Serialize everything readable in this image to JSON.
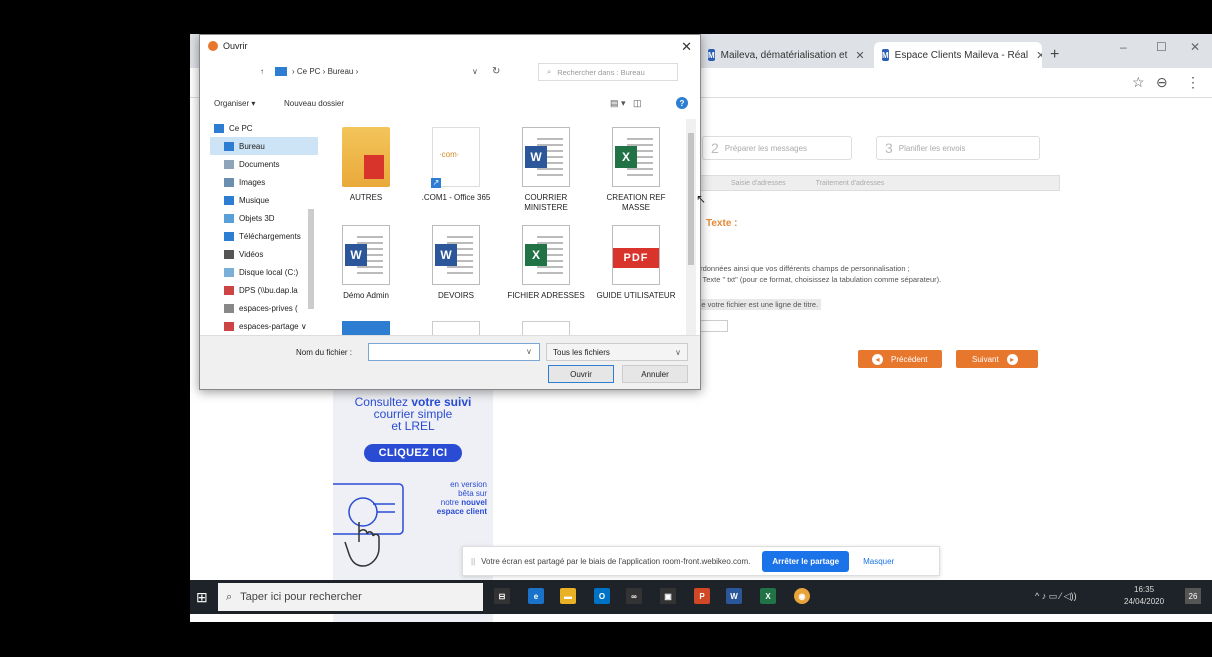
{
  "browser": {
    "tabs": [
      {
        "icon": "M",
        "label": "Maileva, dématérialisation et"
      },
      {
        "icon": "M",
        "label": "Espace Clients Maileva - Réal"
      }
    ],
    "new_tab": "+",
    "win_controls": [
      "–",
      "☐",
      "✕"
    ],
    "star_icon": "☆",
    "profile_icon": "⊖",
    "menu_icon": "⋮"
  },
  "page": {
    "steps": [
      {
        "num": "2",
        "label": "Préparer les messages"
      },
      {
        "num": "3",
        "label": "Planifier les envois"
      }
    ],
    "subtabs": [
      "Saisie d'adresses",
      "Traitement d'adresses"
    ],
    "text_label": "Texte :",
    "paragraph_1": "coordonnées ainsi que vos différents champs de personnalisation ;",
    "paragraph_2": "mat Texte \" txt\" (pour ce format, choisissez la tabulation comme séparateur).",
    "title_row": "e de votre fichier est une ligne de titre.",
    "prev_button": "Précédent",
    "next_button": "Suivant"
  },
  "promo": {
    "line1": "Consultez ",
    "line1_bold": "votre suivi",
    "line2": "courrier simple",
    "line3": "et LREL",
    "button": "CLIQUEZ ICI",
    "small1": "en version",
    "small2": "bêta sur",
    "small3": "notre ",
    "small3_bold": "nouvel",
    "small4": "espace client"
  },
  "share_banner": {
    "handle": "||",
    "text": "Votre écran est partagé par le biais de l'application room-front.webikeo.com.",
    "stop": "Arrêter le partage",
    "hide": "Masquer"
  },
  "taskbar": {
    "search_placeholder": "Taper ici pour rechercher",
    "time": "16:35",
    "date": "24/04/2020",
    "notifications": "26",
    "tray": "^ ♪ ▭ ⁄ ◁))"
  },
  "dialog": {
    "title": "Ouvrir",
    "close": "✕",
    "path": [
      "Ce PC",
      "Bureau"
    ],
    "search_placeholder": "Rechercher dans : Bureau",
    "organize": "Organiser ▾",
    "new_folder": "Nouveau dossier",
    "help": "?",
    "nav": [
      {
        "label": "Ce PC",
        "color": "#2d7dd2",
        "sub": false,
        "sel": false
      },
      {
        "label": "Bureau",
        "color": "#2d7dd2",
        "sub": true,
        "sel": true
      },
      {
        "label": "Documents",
        "color": "#8fa4b8",
        "sub": true,
        "sel": false
      },
      {
        "label": "Images",
        "color": "#6c8fb0",
        "sub": true,
        "sel": false
      },
      {
        "label": "Musique",
        "color": "#2d7dd2",
        "sub": true,
        "sel": false
      },
      {
        "label": "Objets 3D",
        "color": "#5aa0d8",
        "sub": true,
        "sel": false
      },
      {
        "label": "Téléchargements",
        "color": "#2d7dd2",
        "sub": true,
        "sel": false
      },
      {
        "label": "Vidéos",
        "color": "#555555",
        "sub": true,
        "sel": false
      },
      {
        "label": "Disque local (C:)",
        "color": "#7ab0d8",
        "sub": true,
        "sel": false
      },
      {
        "label": "DPS (\\\\bu.dap.la",
        "color": "#c44",
        "sub": true,
        "sel": false
      },
      {
        "label": "espaces-prives (",
        "color": "#888888",
        "sub": true,
        "sel": false
      },
      {
        "label": "espaces-partage ∨",
        "color": "#c44",
        "sub": true,
        "sel": false
      }
    ],
    "files": [
      {
        "name": "AUTRES",
        "kind": "folder"
      },
      {
        "name": ".COM1 - Office 365",
        "kind": "shortcut"
      },
      {
        "name": "COURRIER MINISTERE",
        "kind": "word"
      },
      {
        "name": "CREATION REF MASSE",
        "kind": "excel"
      },
      {
        "name": "Démo Admin",
        "kind": "word"
      },
      {
        "name": "DEVOIRS",
        "kind": "word"
      },
      {
        "name": "FICHIER ADRESSES",
        "kind": "excel"
      },
      {
        "name": "GUIDE UTILISATEUR",
        "kind": "pdf"
      }
    ],
    "filename_label": "Nom du fichier :",
    "filename_value": "",
    "filetype": "Tous les fichiers",
    "open_button": "Ouvrir",
    "cancel_button": "Annuler"
  },
  "colors": {
    "accent_orange": "#e8772e",
    "promo_blue": "#2a4cd4",
    "word_blue": "#2b579a",
    "excel_green": "#217346",
    "pdf_red": "#d9342b"
  }
}
